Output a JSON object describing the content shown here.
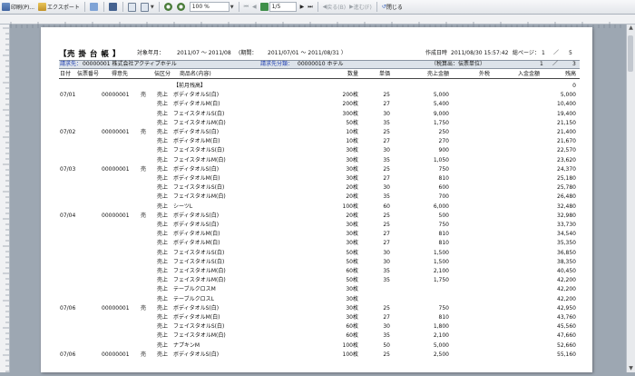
{
  "toolbar": {
    "print_label": "印刷(P)...",
    "export_label": "エクスポート",
    "zoom_value": "100 %",
    "page_value": "1/5",
    "prev_label": "戻る(B)",
    "next_label": "進む(F)",
    "close_label": "閉じる"
  },
  "report": {
    "title": "【売 掛 台 帳 】",
    "period_label": "対象年月：",
    "period_value": "2011/07 ～ 2011/08",
    "range_label": "(期間：",
    "range_value": "2011/07/01 ～ 2011/08/31 ）",
    "created_label": "作成日時",
    "created_value": "2011/08/30 15:57:42",
    "total_pages_label": "総ページ：",
    "page_num": "1",
    "page_slash": "／",
    "page_total": "5",
    "customer_label": "請求先：",
    "customer_value": "00000001 株式会社アクティブホテル",
    "category_label": "請求先分類：",
    "category_value": "00000010 ホテル",
    "tax_label": "（税算出：伝票単位）",
    "sub_page_num": "1",
    "sub_page_slash": "／",
    "sub_page_total": "3"
  },
  "columns": {
    "date": "日付",
    "slip": "伝票番号",
    "ship": "得意先",
    "kbn": "伝区分",
    "item": "商品名(内容)",
    "qty": "数量",
    "price": "単価",
    "amount": "売上金額",
    "tax": "外税",
    "payment": "入金金額",
    "balance": "残高"
  },
  "rows": [
    {
      "date": "",
      "slip": "",
      "ship": "",
      "kbn": "",
      "item": "【前月残高】",
      "qty": "",
      "price": "",
      "amount": "",
      "balance": "0"
    },
    {
      "date": "07/01",
      "slip": "00000001",
      "ship": "売",
      "kbn": "売上",
      "item": "ボディタオルS(白)",
      "qty": "200枚",
      "price": "25",
      "amount": "5,000",
      "balance": "5,000"
    },
    {
      "date": "",
      "slip": "",
      "ship": "",
      "kbn": "売上",
      "item": "ボディタオルM(白)",
      "qty": "200枚",
      "price": "27",
      "amount": "5,400",
      "balance": "10,400"
    },
    {
      "date": "",
      "slip": "",
      "ship": "",
      "kbn": "売上",
      "item": "フェイスタオルS(白)",
      "qty": "300枚",
      "price": "30",
      "amount": "9,000",
      "balance": "19,400"
    },
    {
      "date": "",
      "slip": "",
      "ship": "",
      "kbn": "売上",
      "item": "フェイスタオルM(白)",
      "qty": "50枚",
      "price": "35",
      "amount": "1,750",
      "balance": "21,150"
    },
    {
      "date": "07/02",
      "slip": "00000001",
      "ship": "売",
      "kbn": "売上",
      "item": "ボディタオルS(白)",
      "qty": "10枚",
      "price": "25",
      "amount": "250",
      "balance": "21,400"
    },
    {
      "date": "",
      "slip": "",
      "ship": "",
      "kbn": "売上",
      "item": "ボディタオルM(白)",
      "qty": "10枚",
      "price": "27",
      "amount": "270",
      "balance": "21,670"
    },
    {
      "date": "",
      "slip": "",
      "ship": "",
      "kbn": "売上",
      "item": "フェイスタオルS(白)",
      "qty": "30枚",
      "price": "30",
      "amount": "900",
      "balance": "22,570"
    },
    {
      "date": "",
      "slip": "",
      "ship": "",
      "kbn": "売上",
      "item": "フェイスタオルM(白)",
      "qty": "30枚",
      "price": "35",
      "amount": "1,050",
      "balance": "23,620"
    },
    {
      "date": "07/03",
      "slip": "00000001",
      "ship": "売",
      "kbn": "売上",
      "item": "ボディタオルS(白)",
      "qty": "30枚",
      "price": "25",
      "amount": "750",
      "balance": "24,370"
    },
    {
      "date": "",
      "slip": "",
      "ship": "",
      "kbn": "売上",
      "item": "ボディタオルM(白)",
      "qty": "30枚",
      "price": "27",
      "amount": "810",
      "balance": "25,180"
    },
    {
      "date": "",
      "slip": "",
      "ship": "",
      "kbn": "売上",
      "item": "フェイスタオルS(白)",
      "qty": "20枚",
      "price": "30",
      "amount": "600",
      "balance": "25,780"
    },
    {
      "date": "",
      "slip": "",
      "ship": "",
      "kbn": "売上",
      "item": "フェイスタオルM(白)",
      "qty": "20枚",
      "price": "35",
      "amount": "700",
      "balance": "26,480"
    },
    {
      "date": "",
      "slip": "",
      "ship": "",
      "kbn": "売上",
      "item": "シーツL",
      "qty": "100枚",
      "price": "60",
      "amount": "6,000",
      "balance": "32,480"
    },
    {
      "date": "07/04",
      "slip": "00000001",
      "ship": "売",
      "kbn": "売上",
      "item": "ボディタオルS(白)",
      "qty": "20枚",
      "price": "25",
      "amount": "500",
      "balance": "32,980"
    },
    {
      "date": "",
      "slip": "",
      "ship": "",
      "kbn": "売上",
      "item": "ボディタオルS(白)",
      "qty": "30枚",
      "price": "25",
      "amount": "750",
      "balance": "33,730"
    },
    {
      "date": "",
      "slip": "",
      "ship": "",
      "kbn": "売上",
      "item": "ボディタオルM(白)",
      "qty": "30枚",
      "price": "27",
      "amount": "810",
      "balance": "34,540"
    },
    {
      "date": "",
      "slip": "",
      "ship": "",
      "kbn": "売上",
      "item": "ボディタオルM(白)",
      "qty": "30枚",
      "price": "27",
      "amount": "810",
      "balance": "35,350"
    },
    {
      "date": "",
      "slip": "",
      "ship": "",
      "kbn": "売上",
      "item": "フェイスタオルS(白)",
      "qty": "50枚",
      "price": "30",
      "amount": "1,500",
      "balance": "36,850"
    },
    {
      "date": "",
      "slip": "",
      "ship": "",
      "kbn": "売上",
      "item": "フェイスタオルS(白)",
      "qty": "50枚",
      "price": "30",
      "amount": "1,500",
      "balance": "38,350"
    },
    {
      "date": "",
      "slip": "",
      "ship": "",
      "kbn": "売上",
      "item": "フェイスタオルM(白)",
      "qty": "60枚",
      "price": "35",
      "amount": "2,100",
      "balance": "40,450"
    },
    {
      "date": "",
      "slip": "",
      "ship": "",
      "kbn": "売上",
      "item": "フェイスタオルM(白)",
      "qty": "50枚",
      "price": "35",
      "amount": "1,750",
      "balance": "42,200"
    },
    {
      "date": "",
      "slip": "",
      "ship": "",
      "kbn": "売上",
      "item": "テーブルクロスM",
      "qty": "30枚",
      "price": "",
      "amount": "",
      "balance": "42,200"
    },
    {
      "date": "",
      "slip": "",
      "ship": "",
      "kbn": "売上",
      "item": "テーブルクロスL",
      "qty": "30枚",
      "price": "",
      "amount": "",
      "balance": "42,200"
    },
    {
      "date": "07/06",
      "slip": "00000001",
      "ship": "売",
      "kbn": "売上",
      "item": "ボディタオルS(白)",
      "qty": "30枚",
      "price": "25",
      "amount": "750",
      "balance": "42,950"
    },
    {
      "date": "",
      "slip": "",
      "ship": "",
      "kbn": "売上",
      "item": "ボディタオルM(白)",
      "qty": "30枚",
      "price": "27",
      "amount": "810",
      "balance": "43,760"
    },
    {
      "date": "",
      "slip": "",
      "ship": "",
      "kbn": "売上",
      "item": "フェイスタオルS(白)",
      "qty": "60枚",
      "price": "30",
      "amount": "1,800",
      "balance": "45,560"
    },
    {
      "date": "",
      "slip": "",
      "ship": "",
      "kbn": "売上",
      "item": "フェイスタオルM(白)",
      "qty": "60枚",
      "price": "35",
      "amount": "2,100",
      "balance": "47,660"
    },
    {
      "date": "",
      "slip": "",
      "ship": "",
      "kbn": "売上",
      "item": "ナプキンM",
      "qty": "100枚",
      "price": "50",
      "amount": "5,000",
      "balance": "52,660"
    },
    {
      "date": "07/06",
      "slip": "00000001",
      "ship": "売",
      "kbn": "売上",
      "item": "ボディタオルS(白)",
      "qty": "100枚",
      "price": "25",
      "amount": "2,500",
      "balance": "55,160"
    }
  ]
}
